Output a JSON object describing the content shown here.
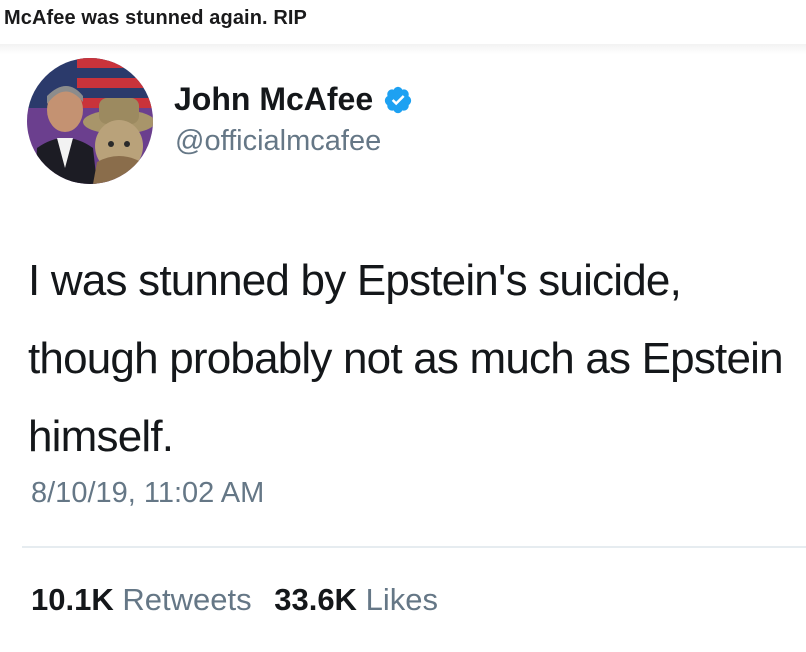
{
  "post": {
    "caption": "McAfee was stunned again. RIP"
  },
  "tweet": {
    "display_name": "John McAfee",
    "handle": "@officialmcafee",
    "verified_icon": "verified-badge-icon",
    "text": "I was stunned by Epstein's suicide, though probably not as much as Epstein himself.",
    "timestamp": "8/10/19, 11:02 AM",
    "retweets_count": "10.1K",
    "retweets_label": "Retweets",
    "likes_count": "33.6K",
    "likes_label": "Likes"
  },
  "colors": {
    "text_primary": "#14171a",
    "text_secondary": "#657786",
    "verified_blue": "#1da1f2",
    "divider": "#e6ecf0"
  }
}
